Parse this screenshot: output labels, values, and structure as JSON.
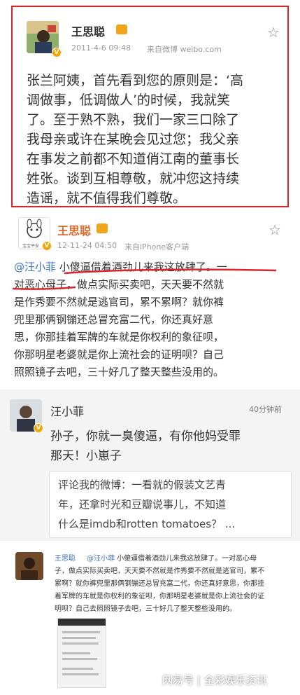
{
  "card1": {
    "user": "王思聪",
    "timestamp": "2011-4-6 09:48",
    "source": "来自微博 weibo.com",
    "lines": [
      "张兰阿姨，首先看到您的原则是：‘高",
      "调做事，低调做人’的时候，我就笑",
      "了。至于熟不熟，我们一家三口除了",
      "我母亲或许在某晚会见过您；我父亲",
      "在事发之前都不知道俏江南的董事长",
      "姓张。谈到互相尊敬，就冲您这持续",
      "造谣，就不值得我们尊敬。"
    ]
  },
  "card2": {
    "user": "王思聪",
    "avatar_caption": "宝宝平安",
    "timestamp": "12-11-24 04:50",
    "source": "来自iPhone客户端",
    "mention": "@汪小菲",
    "line1_rest": " 小傻逼借着酒劲儿来我这放肆了。一",
    "lines": [
      "对恶心母子，做点实际买卖吧，天天要不然就",
      "是作秀要不然就是逃官司，累不累啊？就你裤",
      "兜里那俩钢镚还总冒充富二代，你还真好意",
      "思，你那挂着军牌的车就是你权利的象征呗，",
      "你那明星老婆就是你上流社会的证明呗？自己",
      "照照镜子去吧，三十好几了整天整些没用的。"
    ]
  },
  "card3": {
    "user": "汪小菲",
    "time_ago": "40分钟前",
    "lines": [
      "孙子，你就一臭傻逼，有你他妈受罪",
      "那天！小崽子"
    ],
    "quote_lines": [
      "评论我的微博：一看就的假装文艺青",
      "年，还拿时光和豆瓣说事儿，不知道",
      "什么是imdb和rotten tomatoes？ ..."
    ]
  },
  "card4": {
    "user": "王思聪",
    "mention": "@汪小菲",
    "first_rest": " 小傻逼借着酒劲儿来我这放肆了。一对恶心母",
    "lines": [
      "子，做点实际买卖吧，天天要不然就是作秀要不然就是逃官司，累不",
      "累啊？就你裤兜里那俩钢镚还总冒充富二代，你还真好意思，你那挂",
      "着军牌的车就是你权利的象征呗，你那明星老婆就是你上流社会的证",
      "明呗？自己去照照镜子去吧，三十好几了整天整些没用的。"
    ]
  },
  "watermark": "网易号 | 全彩娱乐资讯",
  "colors": {
    "red_border": "#d9242c",
    "link_blue": "#3b73c4",
    "underline_red": "#d9242c",
    "badge": "#f5a300"
  }
}
